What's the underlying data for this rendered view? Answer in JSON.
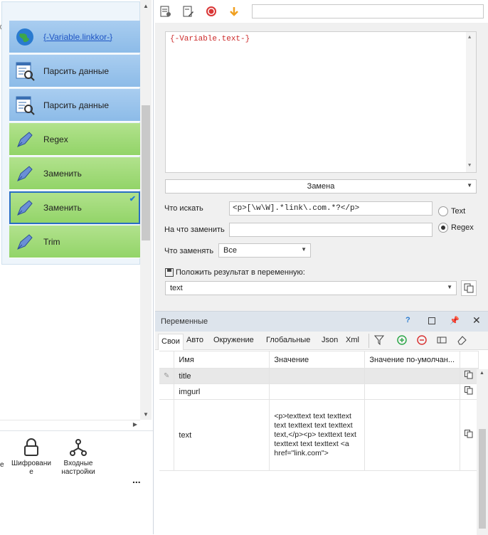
{
  "canvas": {
    "blocks": [
      {
        "label": "{-Variable.linkkor-}",
        "color": "blue",
        "icon": "globe-icon",
        "link": true
      },
      {
        "label": "Парсить данные",
        "color": "blue",
        "icon": "parse-data-icon",
        "link": false
      },
      {
        "label": "Парсить данные",
        "color": "blue",
        "icon": "parse-data-icon",
        "link": false
      },
      {
        "label": "Regex",
        "color": "green",
        "icon": "pen-icon",
        "link": false
      },
      {
        "label": "Заменить",
        "color": "green",
        "icon": "pen-icon",
        "link": false
      },
      {
        "label": "Заменить",
        "color": "green",
        "icon": "pen-icon",
        "link": false,
        "selected": true
      },
      {
        "label": "Trim",
        "color": "green",
        "icon": "pen-icon",
        "link": false
      }
    ]
  },
  "toolbox": {
    "item_cut": "е",
    "encryption_label": "Шифровани е",
    "input_settings_label": "Входные настройки",
    "more_label": "..."
  },
  "editor": {
    "content": "{-Variable.text-}"
  },
  "action": {
    "operation": "Замена",
    "search_label": "Что искать",
    "search_value": "<p>[\\w\\W].*link\\.com.*?</p>",
    "replace_label": "На что заменить",
    "replace_value": "",
    "what_label": "Что заменять",
    "what_value": "Все",
    "radio_text": "Text",
    "radio_regex": "Regex",
    "save_label": "Положить результат в переменную:",
    "save_value": "text"
  },
  "variables": {
    "title": "Переменные",
    "help": "?",
    "tabs": [
      "Свои",
      "Авто",
      "Окружение",
      "Глобальные",
      "Json",
      "Xml"
    ],
    "columns": [
      "Имя",
      "Значение",
      "Значение по-умолчан..."
    ],
    "rows": [
      {
        "name": "title",
        "value": "",
        "default": ""
      },
      {
        "name": "imgurl",
        "value": "",
        "default": ""
      },
      {
        "name": "text",
        "value": "<p>texttext text texttext text texttext text texttext text,</p><p> texttext text texttext text texttext <a href=\"link.com\">",
        "default": ""
      }
    ]
  },
  "colors": {
    "block_blue": "#9cc5ec",
    "block_green": "#a2db79",
    "selection": "#2a6fc2"
  }
}
